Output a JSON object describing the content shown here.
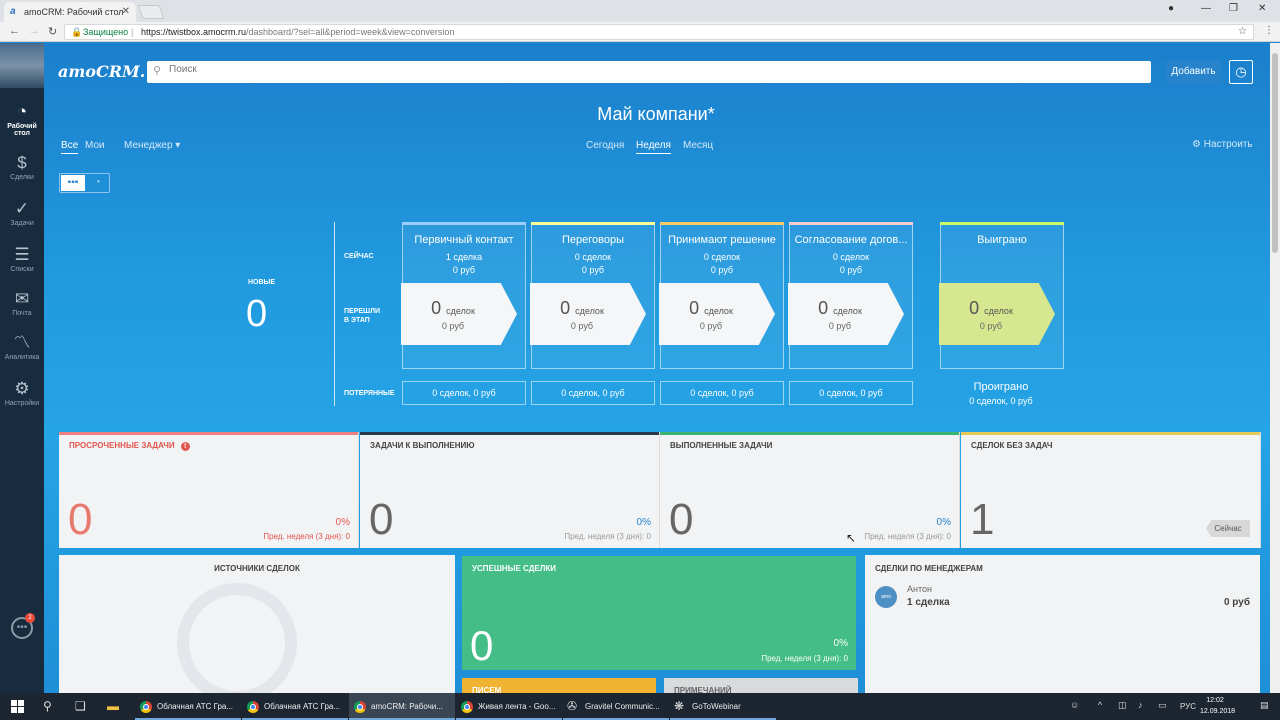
{
  "browser": {
    "tab_title": "amoCRM: Рабочий стол",
    "secure_label": "Защищено",
    "url_host": "https://twistbox.amocrm.ru",
    "url_path": "/dashboard/?sel=all&period=week&view=conversion"
  },
  "sidebar": {
    "items": [
      {
        "label": "Рабочий стол",
        "icon": "dashboard-icon"
      },
      {
        "label": "Сделки",
        "icon": "dollar-icon"
      },
      {
        "label": "Задачи",
        "icon": "check-icon"
      },
      {
        "label": "Списки",
        "icon": "list-icon"
      },
      {
        "label": "Почта",
        "icon": "mail-icon"
      },
      {
        "label": "Аналитика",
        "icon": "analytics-icon"
      },
      {
        "label": "Настройки",
        "icon": "settings-icon"
      }
    ],
    "chat_badge": "2"
  },
  "header": {
    "logo": "amoCRM.",
    "search_placeholder": "Поиск",
    "add_button": "Добавить"
  },
  "dashboard": {
    "title": "Май компани*",
    "filters_left": [
      "Все",
      "Мои",
      "Менеджер"
    ],
    "filters_period": [
      "Сегодня",
      "Неделя",
      "Месяц"
    ],
    "active_period": "Неделя",
    "settings_label": "Настроить"
  },
  "pipeline": {
    "new_label": "НОВЫЕ",
    "new_count": "0",
    "row_now": "СЕЙЧАС",
    "row_moved_1": "ПЕРЕШЛИ",
    "row_moved_2": "В ЭТАП",
    "row_lost": "ПОТЕРЯННЫЕ",
    "deals_unit": "сделок",
    "stages": [
      {
        "name": "Первичный контакт",
        "now_deals": "1 сделка",
        "now_rub": "0 руб",
        "moved": "0",
        "moved_rub": "0 руб",
        "lost": "0 сделок, 0 руб",
        "color": "#99ccff"
      },
      {
        "name": "Переговоры",
        "now_deals": "0 сделок",
        "now_rub": "0 руб",
        "moved": "0",
        "moved_rub": "0 руб",
        "lost": "0 сделок, 0 руб",
        "color": "#ffff99"
      },
      {
        "name": "Принимают решение",
        "now_deals": "0 сделок",
        "now_rub": "0 руб",
        "moved": "0",
        "moved_rub": "0 руб",
        "lost": "0 сделок, 0 руб",
        "color": "#ffcc66"
      },
      {
        "name": "Согласование догов...",
        "now_deals": "0 сделок",
        "now_rub": "0 руб",
        "moved": "0",
        "moved_rub": "0 руб",
        "lost": "0 сделок, 0 руб",
        "color": "#ffcccc"
      }
    ],
    "won": {
      "name": "Выиграно",
      "moved": "0",
      "moved_rub": "0 руб",
      "color": "#ccff66"
    },
    "lost_total": {
      "label": "Проиграно",
      "value": "0 сделок, 0 руб"
    }
  },
  "tasks": {
    "overdue": {
      "title": "ПРОСРОЧЕННЫЕ ЗАДАЧИ",
      "count": "0",
      "pct": "0%",
      "prev": "Пред. неделя (3 дня): 0",
      "color": "#f08080"
    },
    "todo": {
      "title": "ЗАДАЧИ К ВЫПОЛНЕНИЮ",
      "count": "0",
      "color": "#2b3a4a"
    },
    "done": {
      "title": "ВЫПОЛНЕННЫЕ ЗАДАЧИ",
      "count": "0",
      "pct": "0%",
      "prev": "Пред. неделя (3 дня): 0",
      "color": "#3cb371"
    },
    "no_tasks": {
      "title": "СДЕЛОК БЕЗ ЗАДАЧ",
      "count": "1",
      "tag": "Сейчас",
      "color": "#e6c85a"
    },
    "todo_pct": "0%",
    "todo_prev": "Пред. неделя (3 дня): 0"
  },
  "widgets": {
    "sources_title": "ИСТОЧНИКИ СДЕЛОК",
    "success_title": "УСПЕШНЫЕ СДЕЛКИ",
    "success_count": "0",
    "success_pct": "0%",
    "success_prev": "Пред. неделя (3 дня): 0",
    "letters_title": "ПИСЕМ",
    "notes_title": "ПРИМЕЧАНИЙ",
    "managers_title": "СДЕЛКИ ПО МЕНЕДЖЕРАМ",
    "manager_name": "Антон",
    "manager_deals": "1 сделка",
    "manager_rub": "0 руб"
  },
  "taskbar": {
    "apps": [
      {
        "label": "Облачная АТС Гра...",
        "icon": "chrome-icon"
      },
      {
        "label": "Облачная АТС Гра...",
        "icon": "chrome-icon"
      },
      {
        "label": "amoCRM: Рабочи...",
        "icon": "chrome-icon"
      },
      {
        "label": "Живая лента - Goo...",
        "icon": "chrome-icon"
      },
      {
        "label": "Gravitel Communic...",
        "icon": "app-icon"
      },
      {
        "label": "GoToWebinar",
        "icon": "gotowebinar-icon"
      }
    ],
    "lang": "РУС",
    "time": "12:02",
    "date": "12.09.2018"
  }
}
